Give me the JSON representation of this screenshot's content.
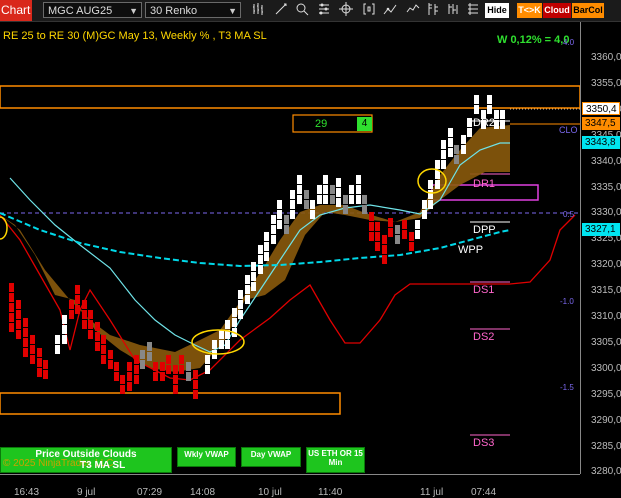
{
  "toolbar": {
    "chart_tab": "Chart",
    "instrument": "MGC AUG25",
    "bar_type": "30 Renko",
    "icons": [
      "bar-style-icon",
      "drawing-tool-icon",
      "zoom-icon",
      "properties-icon",
      "crosshair-icon",
      "brackets-icon",
      "strategy-icon",
      "indicator-icon",
      "template-icon"
    ],
    "buttons": [
      {
        "label": "Hide",
        "bg": "#ffffff",
        "fg": "#000000"
      },
      {
        "label": "T<>K",
        "bg": "#ff8c00",
        "fg": "#ffffff"
      },
      {
        "label": "Cloud",
        "bg": "#c00000",
        "fg": "#ffffff"
      },
      {
        "label": "BarCol",
        "bg": "#ff8c00",
        "fg": "#000000"
      }
    ]
  },
  "chart": {
    "title": "RE 25 to RE 30 (M)GC May 13, Weekly % , T3 MA SL",
    "weekly_pct": "W 0,12% = 4,0",
    "box_value": "29",
    "box_badge": "4",
    "copyright": "© 2025 NinjaTrader, LLC",
    "t3_label": "T3 MA SL"
  },
  "levels": {
    "dr2": "DR2",
    "dr1": "DR1",
    "dpp": "DPP",
    "wpp": "WPP",
    "ds1": "DS1",
    "ds2": "DS2",
    "ds3": "DS3",
    "clo": "CLO",
    "pct_pos05": "0.5",
    "pct_pos40": "4.0",
    "pct_neg10": "-1.0",
    "pct_neg15": "-1.5"
  },
  "price_tags": {
    "last": "3350,4",
    "upper": "3347,5",
    "cyan": "3343,8",
    "vwap": "3327,1"
  },
  "yaxis": [
    "3360,0",
    "3355,0",
    "3350,0",
    "3345,0",
    "3340,0",
    "3335,0",
    "3330,0",
    "3325,0",
    "3320,0",
    "3315,0",
    "3310,0",
    "3305,0",
    "3300,0",
    "3295,0",
    "3290,0",
    "3285,0",
    "3280,0"
  ],
  "xaxis": [
    "16:43",
    "9 jul",
    "07:29",
    "14:08",
    "10 jul",
    "11:40",
    "11 jul",
    "07:44"
  ],
  "bottom_buttons": {
    "price_outside": "Price Outside Clouds",
    "wkly_vwap": "Wkly VWAP",
    "day_vwap": "Day VWAP",
    "us_eth": "US ETH OR 15 Min"
  },
  "colors": {
    "up_bar": "#ffffff",
    "down_bar": "#e00000",
    "gray_bar": "#888888",
    "cloud": "#8a5a0c",
    "cyan": "#00d8e8",
    "stop_line": "#e00000",
    "orange_box": "#ff8c00",
    "magenta": "#e040e0"
  }
}
